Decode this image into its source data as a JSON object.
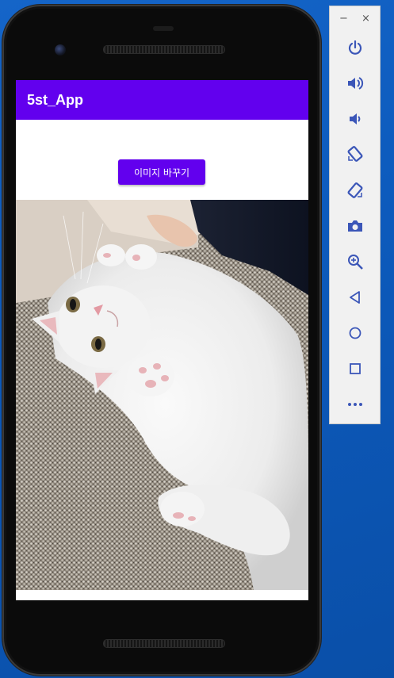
{
  "app": {
    "title": "5st_App"
  },
  "main": {
    "change_image_button": "이미지 바꾸기"
  },
  "colors": {
    "primary": "#6200ee",
    "desktop": "#0d5bbd"
  },
  "emulator_toolbar": {
    "window_minimize": "−",
    "window_close": "×",
    "icons": [
      "power-icon",
      "volume-up-icon",
      "volume-down-icon",
      "rotate-left-icon",
      "rotate-right-icon",
      "camera-icon",
      "zoom-icon",
      "back-icon",
      "home-icon",
      "overview-icon",
      "more-icon"
    ]
  }
}
